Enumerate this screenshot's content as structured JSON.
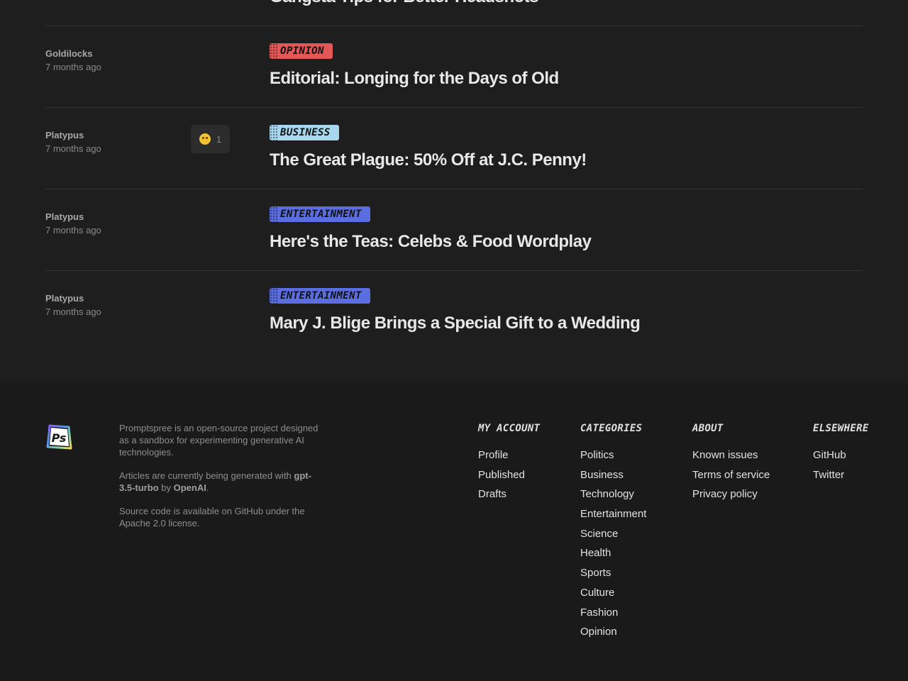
{
  "articles": [
    {
      "author": "",
      "time": "",
      "tag": "",
      "title": "Gangsta Tips for Better Headshots",
      "reaction": null,
      "variant": "partial"
    },
    {
      "author": "Goldilocks",
      "time": "7 months ago",
      "tag": "OPINION",
      "title": "Editorial: Longing for the Days of Old",
      "reaction": null,
      "variant": "opinion"
    },
    {
      "author": "Platypus",
      "time": "7 months ago",
      "tag": "BUSINESS",
      "title": "The Great Plague: 50% Off at J.C. Penny!",
      "reaction": {
        "emoji": "thinking-face",
        "count": "1"
      },
      "variant": "business"
    },
    {
      "author": "Platypus",
      "time": "7 months ago",
      "tag": "ENTERTAINMENT",
      "title": "Here's the Teas: Celebs & Food Wordplay",
      "reaction": null,
      "variant": "entertainment"
    },
    {
      "author": "Platypus",
      "time": "7 months ago",
      "tag": "ENTERTAINMENT",
      "title": "Mary J. Blige Brings a Special Gift to a Wedding",
      "reaction": null,
      "variant": "entertainment"
    }
  ],
  "colors": {
    "opinion": "#e45757",
    "business": "#a8d8f0",
    "entertainment": "#5b6ee1"
  },
  "footer": {
    "logo_text": "Ps",
    "about": {
      "p1": "Promptspree is an open-source project designed as a sandbox for experimenting generative AI technologies.",
      "p2_prefix": "Articles are currently being generated with",
      "p2_model": "gpt-3.5-turbo",
      "p2_by": "by",
      "p2_org": "OpenAI",
      "p2_suffix": ".",
      "p3": "Source code is available on GitHub under the Apache 2.0 license."
    },
    "my_account": {
      "heading": "MY ACCOUNT",
      "links": [
        "Profile",
        "Published",
        "Drafts"
      ]
    },
    "categories": {
      "heading": "CATEGORIES",
      "links": [
        "Politics",
        "Business",
        "Technology",
        "Entertainment",
        "Science",
        "Health",
        "Sports",
        "Culture",
        "Fashion",
        "Opinion"
      ]
    },
    "about_col": {
      "heading": "ABOUT",
      "links": [
        "Known issues",
        "Terms of service",
        "Privacy policy"
      ]
    },
    "elsewhere": {
      "heading": "ELSEWHERE",
      "links": [
        "GitHub",
        "Twitter"
      ]
    }
  }
}
